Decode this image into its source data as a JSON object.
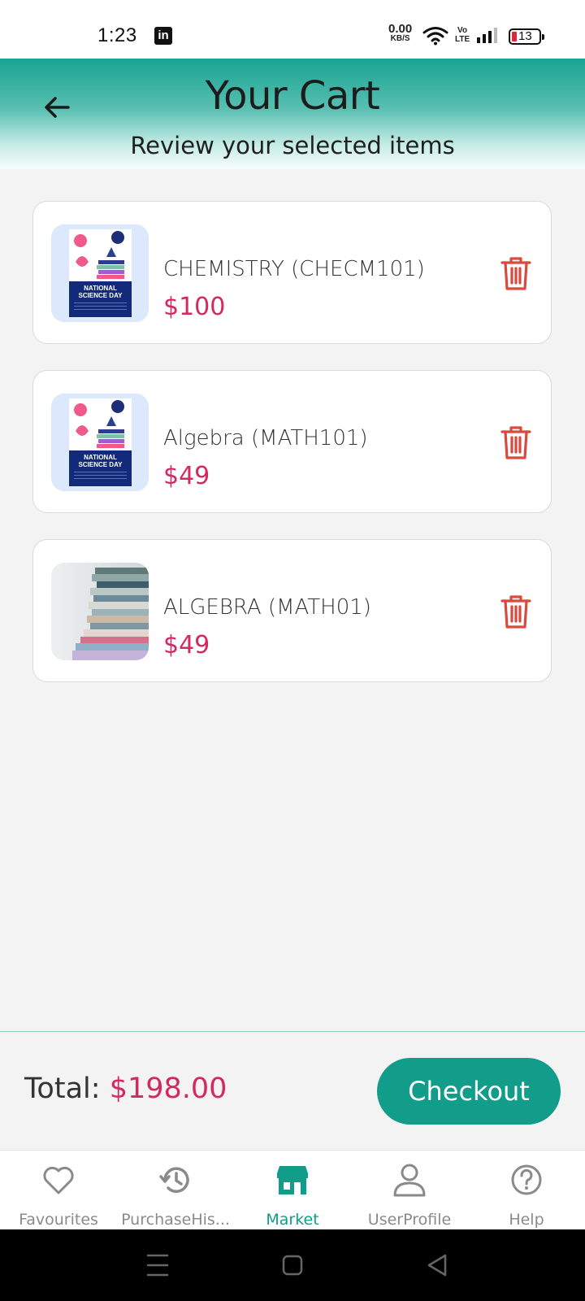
{
  "status_bar": {
    "time": "1:23",
    "app_icon": "linkedin-icon",
    "net_speed": "0.00",
    "net_unit": "KB/S",
    "volte_top": "Vo",
    "volte_bottom": "LTE",
    "battery": "13",
    "battery_color": "#e0243a"
  },
  "header": {
    "title": "Your Cart",
    "subtitle": "Review your selected items",
    "back_icon": "arrow-left-icon",
    "gradient_color": "#17a392"
  },
  "cart": {
    "items": [
      {
        "name": "CHEMISTRY (CHECM101)",
        "price": "$100",
        "thumbnail": "national-science-day-poster",
        "poster_text_1": "NATIONAL",
        "poster_text_2": "SCIENCE DAY"
      },
      {
        "name": "Algebra (MATH101)",
        "price": "$49",
        "thumbnail": "national-science-day-poster",
        "poster_text_1": "NATIONAL",
        "poster_text_2": "SCIENCE DAY"
      },
      {
        "name": "ALGEBRA (MATH01)",
        "price": "$49",
        "thumbnail": "stack-of-books-photo"
      }
    ],
    "delete_icon": "trash-icon",
    "price_color": "#d4285f",
    "delete_color": "#d9493e"
  },
  "footer": {
    "total_label": "Total:",
    "total_value": "$198.00",
    "checkout_label": "Checkout",
    "accent": "#129c8a"
  },
  "bottom_nav": {
    "items": [
      {
        "label": "Favourites",
        "icon": "heart-icon",
        "active": false
      },
      {
        "label": "PurchaseHis...",
        "icon": "history-icon",
        "active": false
      },
      {
        "label": "Market",
        "icon": "store-icon",
        "active": true
      },
      {
        "label": "UserProfile",
        "icon": "user-icon",
        "active": false
      },
      {
        "label": "Help",
        "icon": "help-icon",
        "active": false
      }
    ]
  },
  "system_nav": {
    "buttons": [
      "menu-icon",
      "home-icon",
      "back-triangle-icon"
    ]
  }
}
